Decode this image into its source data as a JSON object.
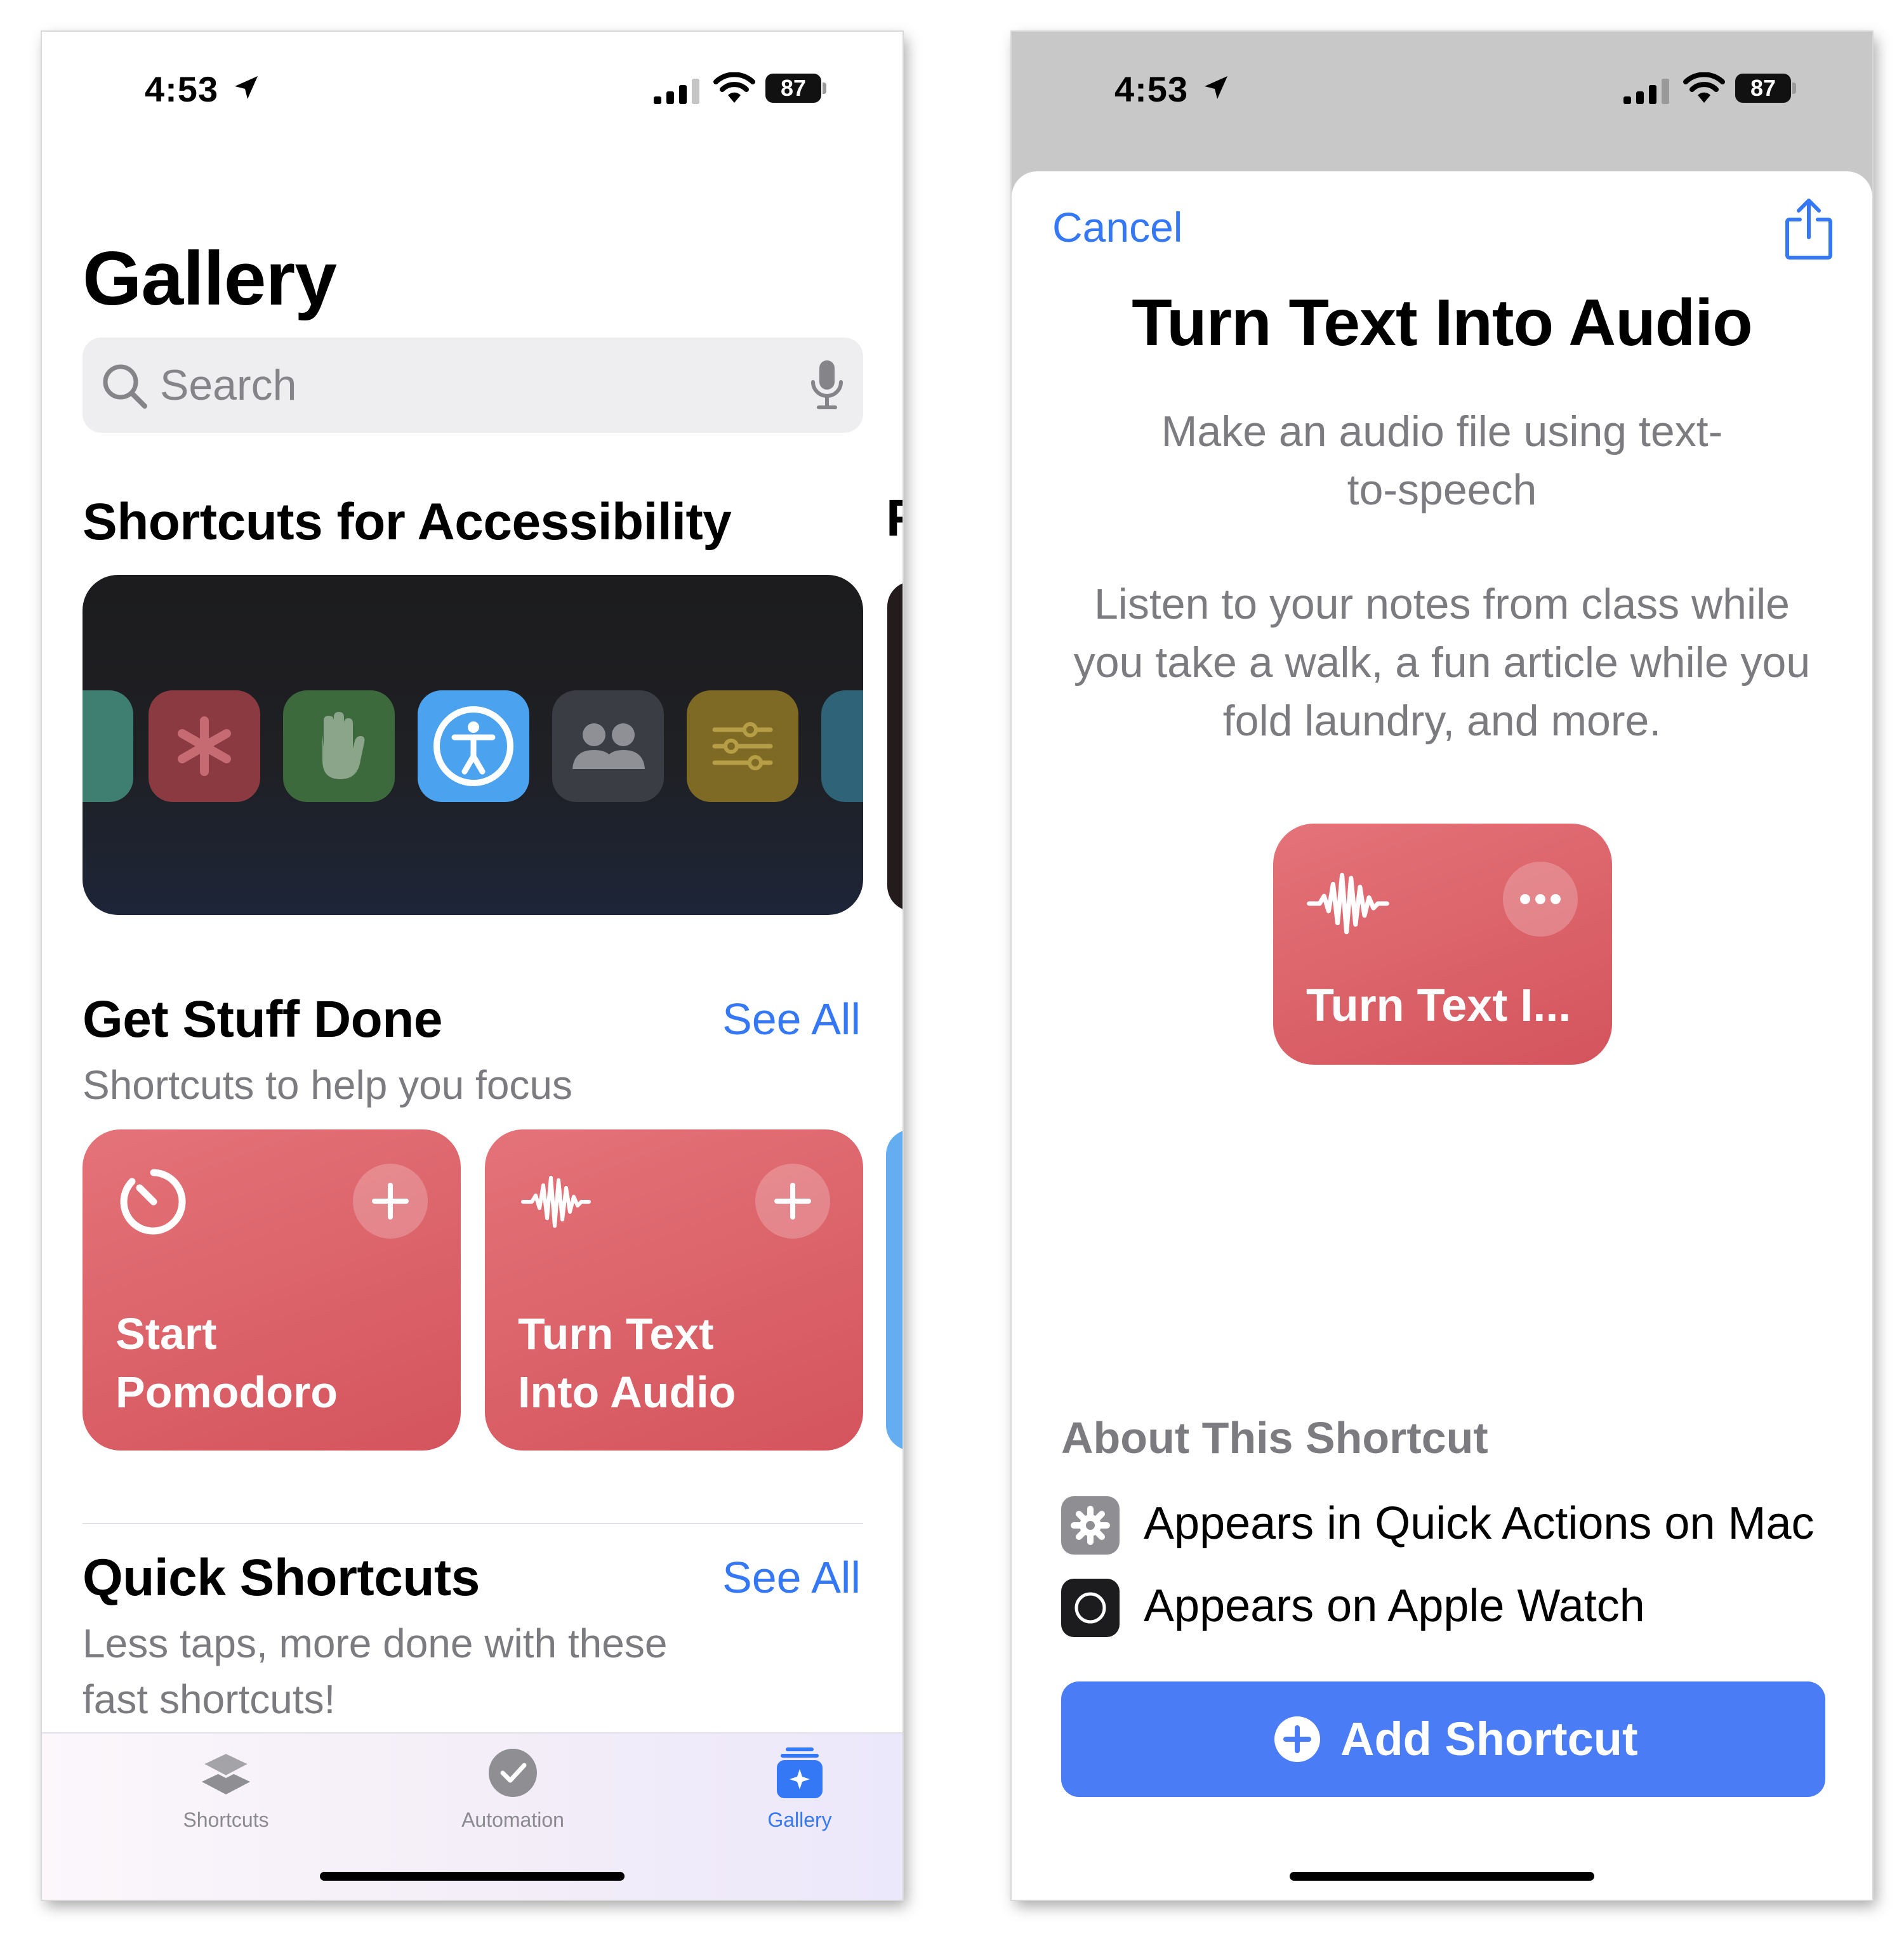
{
  "status": {
    "time": "4:53",
    "battery": "87",
    "signal_bars": 3
  },
  "left": {
    "title": "Gallery",
    "search": {
      "placeholder": "Search"
    },
    "accessibility": {
      "title": "Shortcuts for Accessibility",
      "next_peek": "F"
    },
    "hero_icons": [
      {
        "name": "partial-icon",
        "color": "#3f7f72"
      },
      {
        "name": "asterisk-icon",
        "color": "#8a3a40"
      },
      {
        "name": "hand-icon",
        "color": "#3d6a3c"
      },
      {
        "name": "accessibility-icon",
        "color": "#4ba3f0"
      },
      {
        "name": "people-icon",
        "color": "#3b3d44"
      },
      {
        "name": "sliders-icon",
        "color": "#7f6a25"
      },
      {
        "name": "partial-icon-right",
        "color": "#2f6478"
      }
    ],
    "get_stuff_done": {
      "title": "Get Stuff Done",
      "see_all": "See All",
      "subtitle": "Shortcuts to help you focus"
    },
    "cards": [
      {
        "line1": "Start",
        "line2": "Pomodoro",
        "icon": "timer-icon"
      },
      {
        "line1": "Turn Text",
        "line2": "Into Audio",
        "icon": "waveform-icon"
      }
    ],
    "quick_shortcuts": {
      "title": "Quick Shortcuts",
      "see_all": "See All",
      "subtitle_line1": "Less taps, more done with these",
      "subtitle_line2": "fast shortcuts!"
    },
    "tabs": [
      {
        "label": "Shortcuts",
        "icon": "layers-icon",
        "active": false
      },
      {
        "label": "Automation",
        "icon": "checkmark-clock-icon",
        "active": false
      },
      {
        "label": "Gallery",
        "icon": "gallery-icon",
        "active": true
      }
    ]
  },
  "right": {
    "cancel": "Cancel",
    "title": "Turn Text Into Audio",
    "subtitle_line1": "Make an audio file using text-",
    "subtitle_line2": "to-speech",
    "desc_line1": "Listen to your notes from class while",
    "desc_line2": "you take a walk, a fun article while you",
    "desc_line3": "fold laundry, and more.",
    "card_label": "Turn Text I...",
    "about": {
      "title": "About This Shortcut",
      "items": [
        {
          "text": "Appears in Quick Actions on Mac",
          "icon": "gear-icon"
        },
        {
          "text": "Appears on Apple Watch",
          "icon": "watch-icon"
        }
      ]
    },
    "add_button": "Add Shortcut"
  },
  "colors": {
    "accent": "#3478f6",
    "card_red": "#dc5f66",
    "add_button": "#4a7cf6"
  }
}
